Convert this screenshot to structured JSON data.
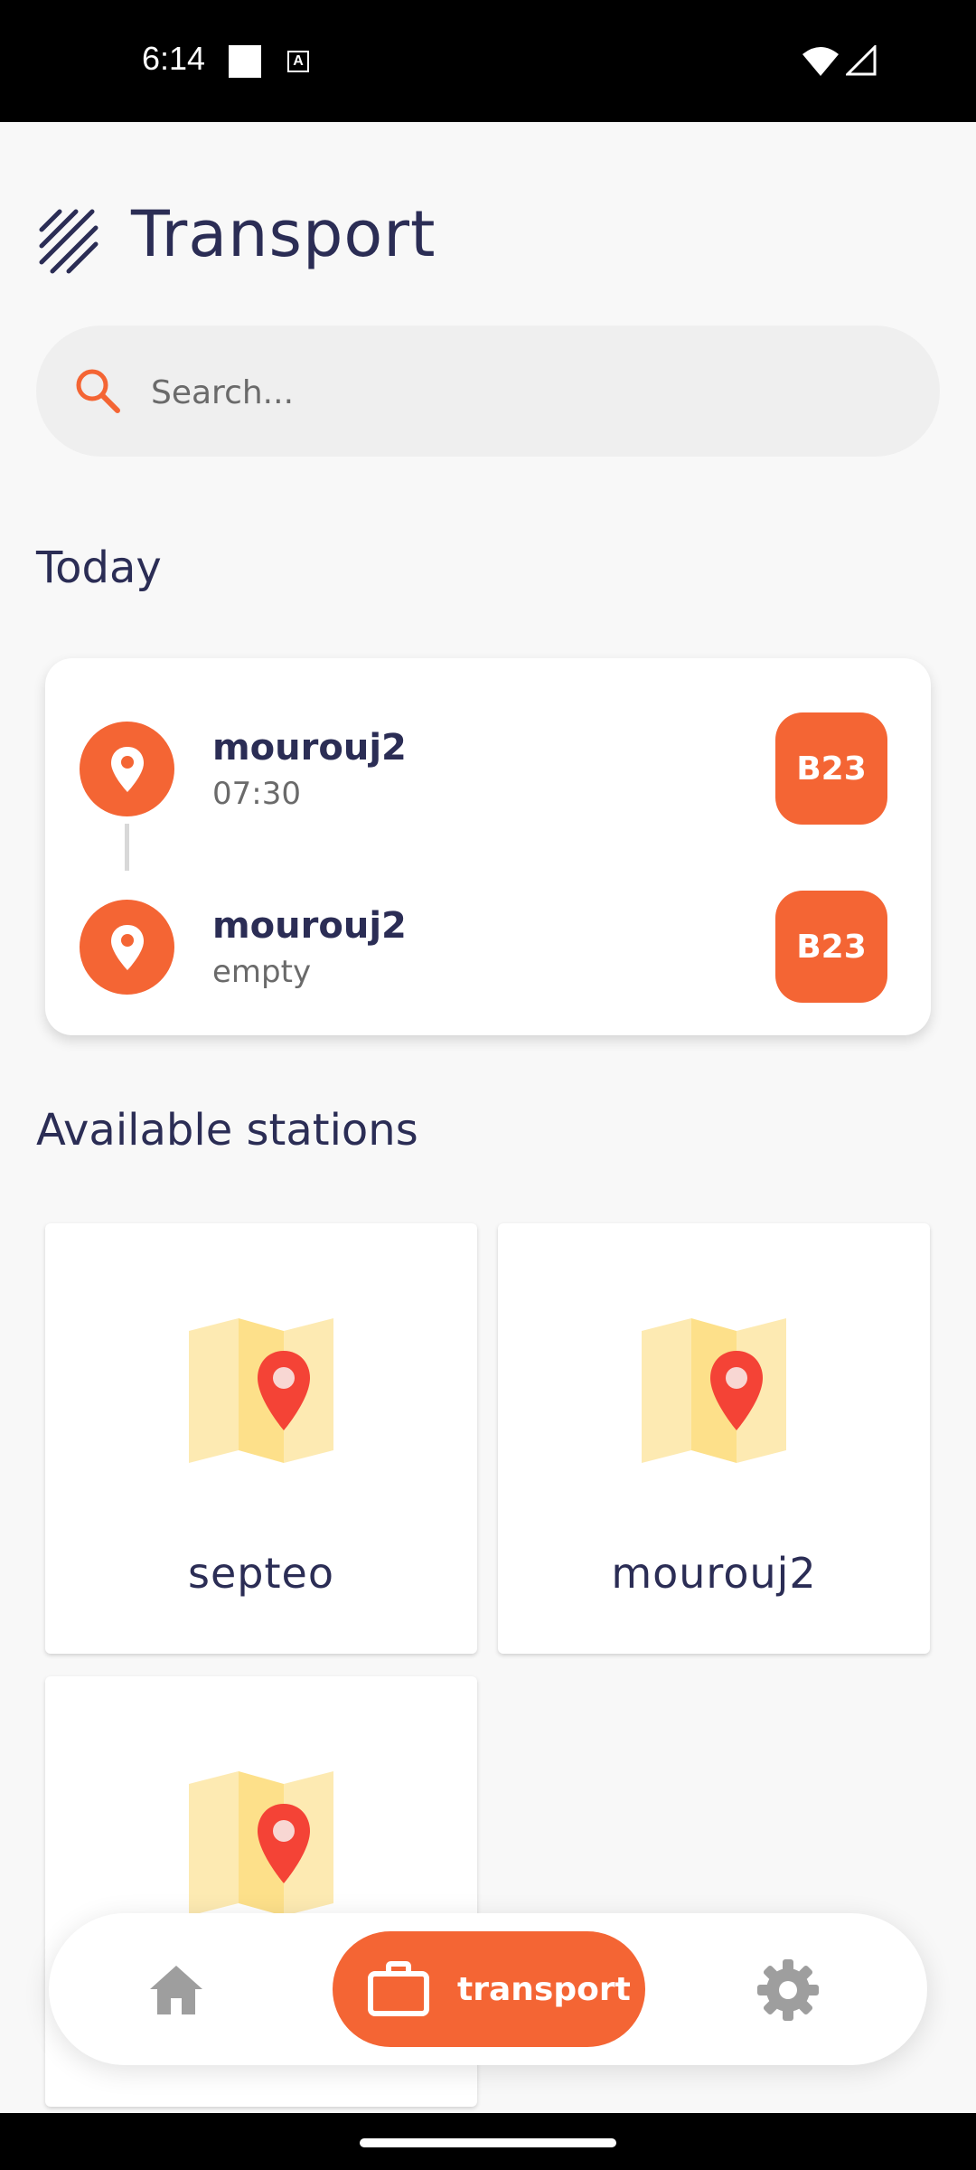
{
  "status_bar": {
    "time": "6:14",
    "notif_icon_label": "A"
  },
  "header": {
    "title": "Transport"
  },
  "search": {
    "placeholder": "Search..."
  },
  "today": {
    "title": "Today",
    "trips": [
      {
        "name": "mourouj2",
        "subtitle": "07:30",
        "badge": "B23"
      },
      {
        "name": "mourouj2",
        "subtitle": "empty",
        "badge": "B23"
      }
    ]
  },
  "stations": {
    "title": "Available stations",
    "items": [
      {
        "name": "septeo"
      },
      {
        "name": "mourouj2"
      },
      {
        "name": ""
      }
    ]
  },
  "bottom_nav": {
    "items": [
      {
        "icon": "home-icon",
        "label": ""
      },
      {
        "icon": "briefcase-icon",
        "label": "transport",
        "active": true
      },
      {
        "icon": "gear-icon",
        "label": ""
      }
    ]
  },
  "colors": {
    "accent": "#f46534",
    "text": "#2b2d55",
    "map_light": "#fdeab2",
    "map_mid": "#fde08a",
    "pin": "#f44336"
  }
}
